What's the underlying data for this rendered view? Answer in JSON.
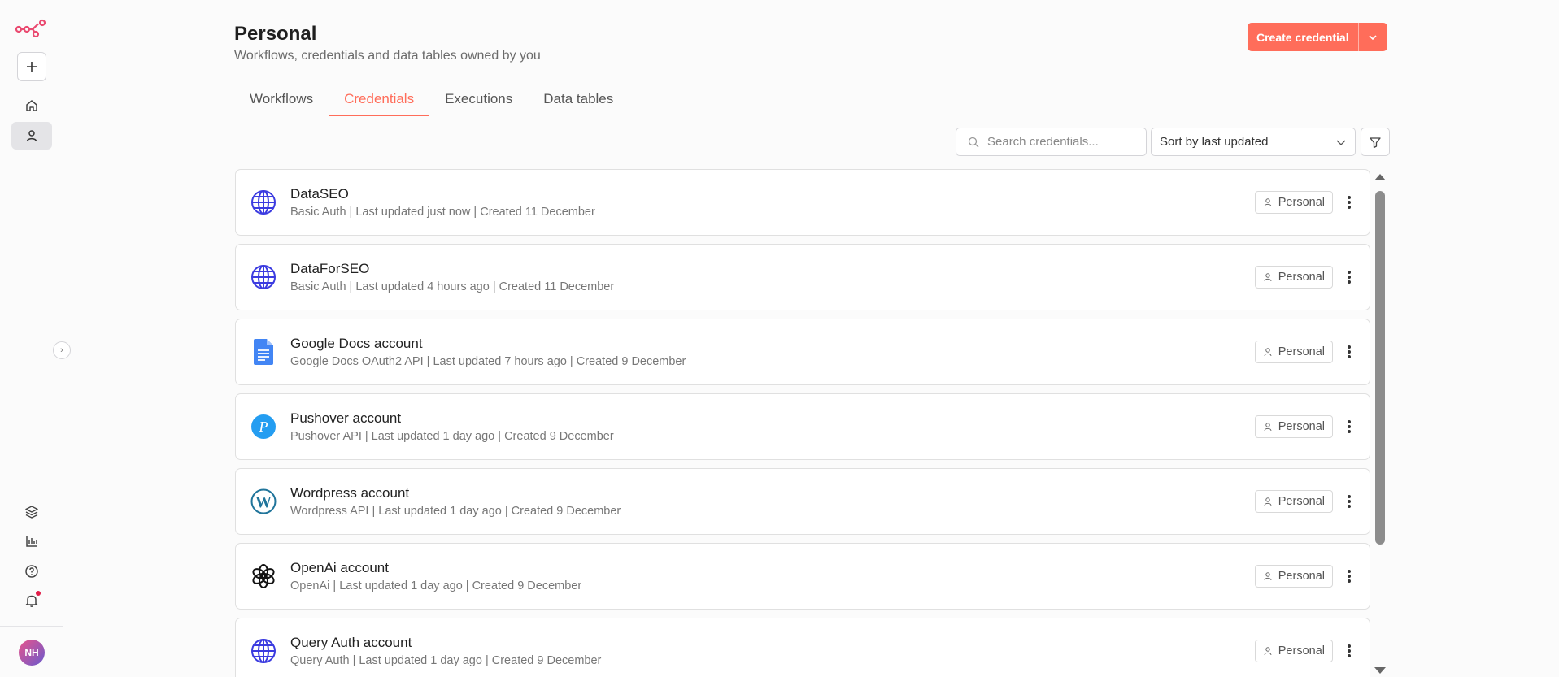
{
  "sidebar": {
    "collapse_label": "›",
    "avatar_initials": "NH"
  },
  "header": {
    "title": "Personal",
    "subtitle": "Workflows, credentials and data tables owned by you",
    "create_button_label": "Create credential"
  },
  "tabs": [
    {
      "label": "Workflows",
      "active": false
    },
    {
      "label": "Credentials",
      "active": true
    },
    {
      "label": "Executions",
      "active": false
    },
    {
      "label": "Data tables",
      "active": false
    }
  ],
  "toolbar": {
    "search_placeholder": "Search credentials...",
    "sort_value": "Sort by last updated"
  },
  "credentials": [
    {
      "name": "DataSEO",
      "meta": "Basic Auth | Last updated just now | Created 11 December",
      "owner": "Personal",
      "icon": "globe-icon"
    },
    {
      "name": "DataForSEO",
      "meta": "Basic Auth | Last updated 4 hours ago | Created 11 December",
      "owner": "Personal",
      "icon": "globe-icon"
    },
    {
      "name": "Google Docs account",
      "meta": "Google Docs OAuth2 API | Last updated 7 hours ago | Created 9 December",
      "owner": "Personal",
      "icon": "google-docs-icon"
    },
    {
      "name": "Pushover account",
      "meta": "Pushover API | Last updated 1 day ago | Created 9 December",
      "owner": "Personal",
      "icon": "pushover-icon"
    },
    {
      "name": "Wordpress account",
      "meta": "Wordpress API | Last updated 1 day ago | Created 9 December",
      "owner": "Personal",
      "icon": "wordpress-icon"
    },
    {
      "name": "OpenAi account",
      "meta": "OpenAi | Last updated 1 day ago | Created 9 December",
      "owner": "Personal",
      "icon": "openai-icon"
    },
    {
      "name": "Query Auth account",
      "meta": "Query Auth | Last updated 1 day ago | Created 9 December",
      "owner": "Personal",
      "icon": "globe-icon"
    }
  ],
  "colors": {
    "accent": "#ff6d5a",
    "globe": "#3b3be0",
    "google_docs": "#4285f4",
    "pushover": "#249df1",
    "wordpress": "#21759b"
  }
}
